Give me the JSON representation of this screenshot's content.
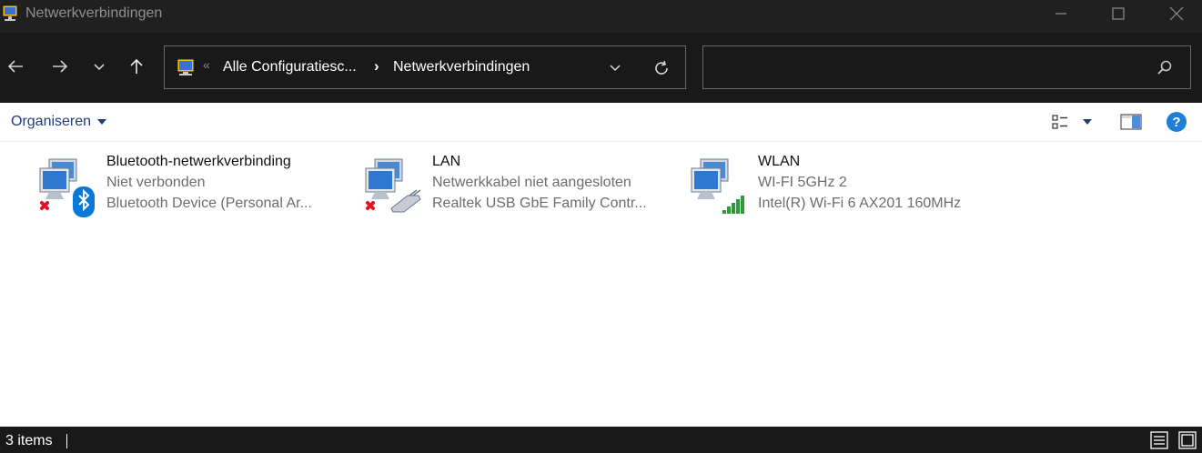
{
  "window": {
    "title": "Netwerkverbindingen",
    "controls": [
      "minimize",
      "maximize",
      "close"
    ]
  },
  "navigation": {
    "back_icon": "arrow-left-icon",
    "forward_icon": "arrow-right-icon",
    "recent_icon": "chevron-down-icon",
    "up_icon": "arrow-up-icon",
    "address": {
      "overflow_marker": "«",
      "breadcrumbs": [
        "Alle Configuratiesc...",
        "Netwerkverbindingen"
      ],
      "separator": "›"
    },
    "search": {
      "value": "",
      "placeholder": ""
    }
  },
  "commandbar": {
    "organise_label": "Organiseren",
    "right_icons": [
      "change-view-icon",
      "preview-pane-icon",
      "help-icon"
    ]
  },
  "connections": [
    {
      "name": "Bluetooth-netwerkverbinding",
      "status": "Niet verbonden",
      "device": "Bluetooth Device (Personal Ar...",
      "icon": "bluetooth-network-icon",
      "overlay": "disconnected-x-icon"
    },
    {
      "name": "LAN",
      "status": "Netwerkkabel niet aangesloten",
      "device": "Realtek USB GbE Family Contr...",
      "icon": "ethernet-network-icon",
      "overlay": "disconnected-x-icon"
    },
    {
      "name": "WLAN",
      "status": "WI-FI 5GHz 2",
      "device": "Intel(R) Wi-Fi 6 AX201 160MHz",
      "icon": "wifi-network-icon",
      "overlay": "signal-bars-icon"
    }
  ],
  "statusbar": {
    "item_count": "3 items",
    "view_icons": [
      "details-view-icon",
      "large-icons-view-icon"
    ]
  },
  "colors": {
    "titlebar_bg": "#202020",
    "navbar_bg": "#191919",
    "link_blue": "#1f3e78",
    "help_blue": "#1f7fd6",
    "error_red": "#e81123",
    "bluetooth_blue": "#0a78d7",
    "signal_green": "#2e9a3a"
  }
}
